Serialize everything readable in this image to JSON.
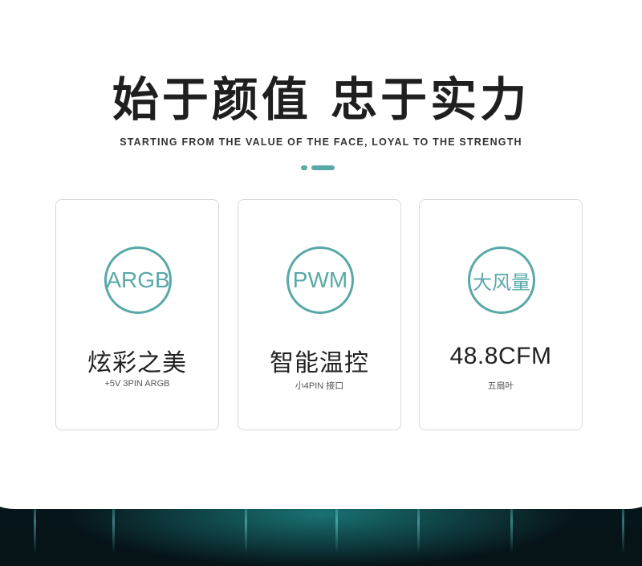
{
  "header": {
    "headline": "始于颜值 忠于实力",
    "subline": "STARTING FROM THE VALUE OF THE FACE, LOYAL TO THE STRENGTH"
  },
  "features": [
    {
      "badge": "ARGB",
      "title": "炫彩之美",
      "sub": "+5V 3PIN ARGB"
    },
    {
      "badge": "PWM",
      "title": "智能温控",
      "sub": "小4PIN 接口"
    },
    {
      "badge": "大风量",
      "title": "48.8CFM",
      "sub": "五扇叶"
    }
  ],
  "colors": {
    "accent": "#5aa8a8",
    "text": "#222222",
    "background_bottom": "#06151a"
  }
}
